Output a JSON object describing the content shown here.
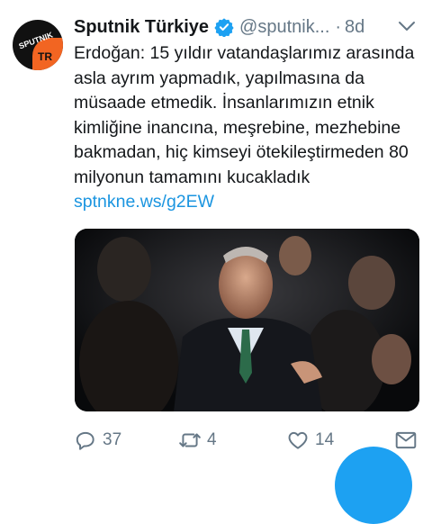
{
  "tweet": {
    "display_name": "Sputnik Türkiye",
    "handle": "@sputnik...",
    "separator": "·",
    "time": "8d",
    "text": "Erdoğan: 15 yıldır vatandaşlarımız arasında asla ayrım yapmadık, yapılmasına da müsaade etmedik. İnsanlarımızın etnik kimliğine inancına, meşrebine, mezhebine bakmadan, hiç kimseyi ötekileştirmeden 80 milyonun tamamını kucakladık",
    "link": "sptnkne.ws/g2EW"
  },
  "avatar": {
    "brand": "SPUTNIK",
    "tr": "TR"
  },
  "actions": {
    "replies": "37",
    "retweets": "4",
    "likes": "14"
  },
  "colors": {
    "link": "#1b95e0",
    "verified": "#1da1f2",
    "muted": "#657786",
    "brand_orange": "#f26522"
  },
  "icons": [
    "verified-icon",
    "chevron-down-icon",
    "reply-icon",
    "retweet-icon",
    "like-icon",
    "direct-message-icon"
  ]
}
